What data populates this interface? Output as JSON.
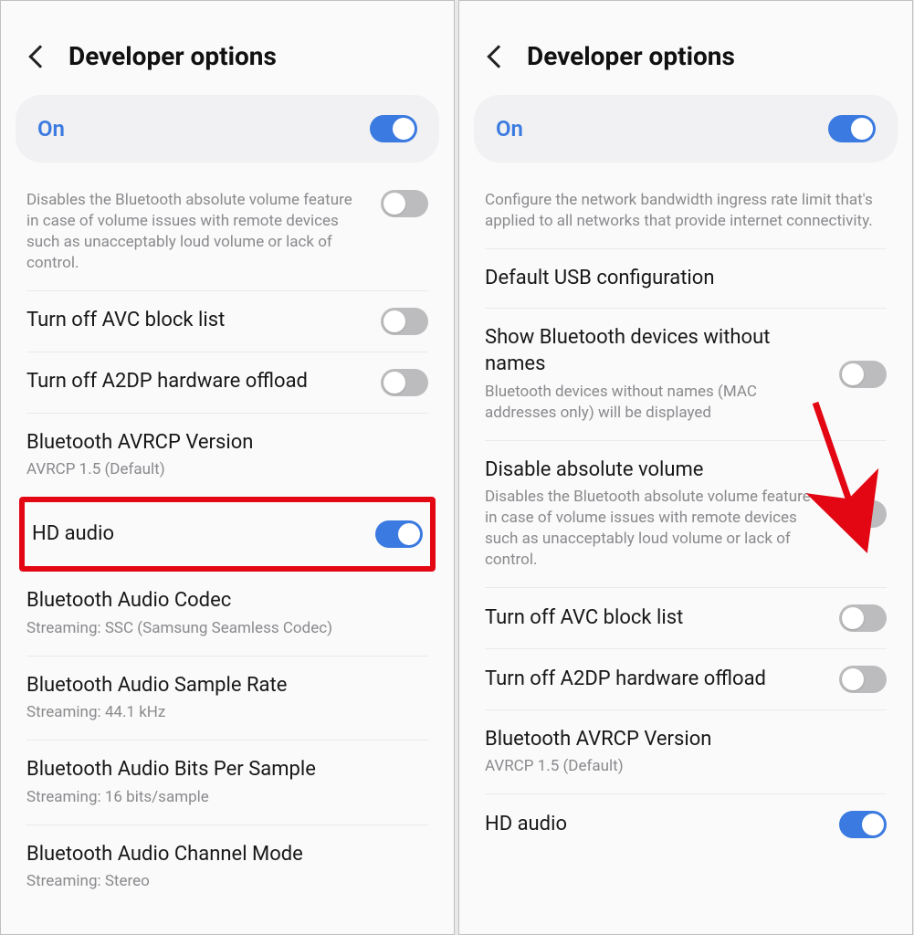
{
  "left": {
    "header": {
      "title": "Developer options"
    },
    "on_bar": {
      "label": "On",
      "state": "on"
    },
    "truncated": {
      "sub": "Disables the Bluetooth absolute volume feature in case of volume issues with remote devices such as unacceptably loud volume or lack of control.",
      "toggle": "off"
    },
    "items": [
      {
        "title": "Turn off AVC block list",
        "sub": null,
        "toggle": "off"
      },
      {
        "title": "Turn off A2DP hardware offload",
        "sub": null,
        "toggle": "off"
      },
      {
        "title": "Bluetooth AVRCP Version",
        "sub": "AVRCP 1.5 (Default)",
        "toggle": null
      },
      {
        "title": "HD audio",
        "sub": null,
        "toggle": "on",
        "highlight": true
      },
      {
        "title": "Bluetooth Audio Codec",
        "sub": "Streaming: SSC (Samsung Seamless Codec)",
        "toggle": null
      },
      {
        "title": "Bluetooth Audio Sample Rate",
        "sub": "Streaming: 44.1 kHz",
        "toggle": null
      },
      {
        "title": "Bluetooth Audio Bits Per Sample",
        "sub": "Streaming: 16 bits/sample",
        "toggle": null
      },
      {
        "title": "Bluetooth Audio Channel Mode",
        "sub": "Streaming: Stereo",
        "toggle": null
      }
    ]
  },
  "right": {
    "header": {
      "title": "Developer options"
    },
    "on_bar": {
      "label": "On",
      "state": "on"
    },
    "truncated": {
      "sub": "Configure the network bandwidth ingress rate limit that's applied to all networks that provide internet connectivity."
    },
    "items": [
      {
        "title": "Default USB configuration",
        "sub": null,
        "toggle": null
      },
      {
        "title": "Show Bluetooth devices without names",
        "sub": "Bluetooth devices without names (MAC addresses only) will be displayed",
        "toggle": "off"
      },
      {
        "title": "Disable absolute volume",
        "sub": "Disables the Bluetooth absolute volume feature in case of volume issues with remote devices such as unacceptably loud volume or lack of control.",
        "toggle": "off",
        "arrow": true
      },
      {
        "title": "Turn off AVC block list",
        "sub": null,
        "toggle": "off"
      },
      {
        "title": "Turn off A2DP hardware offload",
        "sub": null,
        "toggle": "off"
      },
      {
        "title": "Bluetooth AVRCP Version",
        "sub": "AVRCP 1.5 (Default)",
        "toggle": null
      },
      {
        "title": "HD audio",
        "sub": null,
        "toggle": "on"
      }
    ]
  }
}
